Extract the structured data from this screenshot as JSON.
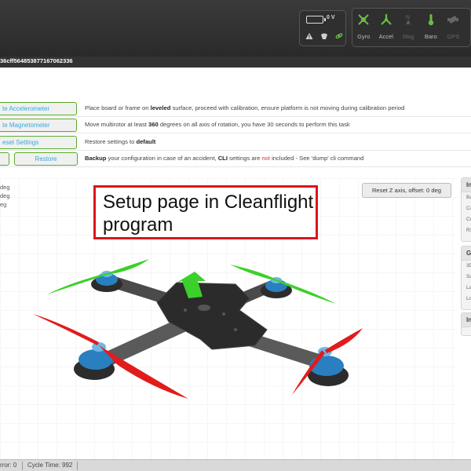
{
  "header": {
    "voltage": "0 V",
    "status_icons": [
      "warning-icon",
      "failsafe-icon",
      "link-icon"
    ],
    "sensors": [
      {
        "label": "Gyro",
        "active": true,
        "icon": "gyro-icon"
      },
      {
        "label": "Accel",
        "active": true,
        "icon": "accel-icon"
      },
      {
        "label": "Mag",
        "active": false,
        "icon": "mag-icon",
        "glyph": "N"
      },
      {
        "label": "Baro",
        "active": true,
        "icon": "baro-icon"
      },
      {
        "label": "GPS",
        "active": false,
        "icon": "gps-icon"
      }
    ],
    "colors": {
      "active": "#69bd45",
      "inactive": "#666666"
    }
  },
  "id_bar": {
    "text": "36cff564853877167062336"
  },
  "actions": [
    {
      "button": "te Accelerometer",
      "description_parts": [
        {
          "text": "Place board or frame on "
        },
        {
          "text": "leveled",
          "bold": true
        },
        {
          "text": " surface, proceed with calibration, ensure platform is not moving during calibration period"
        }
      ]
    },
    {
      "button": "te Magnetometer",
      "description_parts": [
        {
          "text": "Move multirotor at least "
        },
        {
          "text": "360",
          "bold": true
        },
        {
          "text": " degrees on all axis of rotation, you have 30 seconds to perform this task"
        }
      ]
    },
    {
      "button": "eset Settings",
      "description_parts": [
        {
          "text": "Restore settings to "
        },
        {
          "text": "default",
          "bold": true
        }
      ]
    },
    {
      "button_restore": "Restore",
      "description_parts": [
        {
          "text": "Backup",
          "bold": true
        },
        {
          "text": " your configuration in case of an accident, "
        },
        {
          "text": "CLI",
          "bold": true
        },
        {
          "text": " settings are "
        },
        {
          "text": "not",
          "red": true
        },
        {
          "text": " included - See 'dump' cli command"
        }
      ]
    }
  ],
  "model": {
    "angles": [
      "deg",
      "deg",
      "eg"
    ],
    "reset_button": "Reset Z axis, offset: 0 deg",
    "caption": "Setup page in Cleanflight program"
  },
  "side": {
    "info_head": "In",
    "info_lines": [
      "Ba",
      "Ca",
      "Co",
      "RS"
    ],
    "gps_head": "G",
    "gps_lines": [
      "3D",
      "Sa",
      "La",
      "Lo"
    ],
    "inst_head": "In"
  },
  "footer": {
    "left": "rror: 0",
    "cycle": "Cycle Time: 992"
  }
}
